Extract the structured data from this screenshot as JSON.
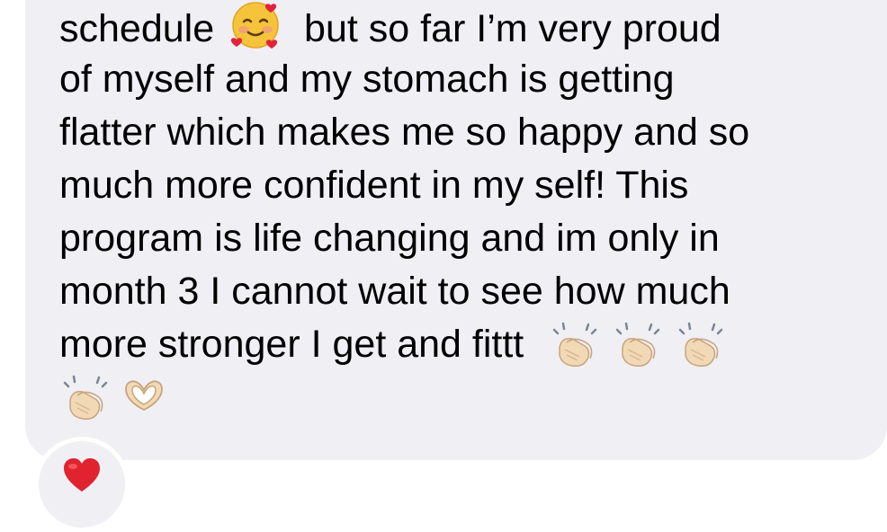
{
  "message": {
    "lines": [
      "schedule",
      "but so far I’m very proud",
      "of myself and my stomach is getting",
      "flatter which makes me so happy and so",
      "much more confident in my self! This",
      "program is life changing and im only in",
      "month 3 I cannot wait to see how much",
      "more stronger I get and fittt"
    ],
    "emojis": [
      "smiling-face-with-hearts-icon",
      "clapping-hands-icon",
      "clapping-hands-icon",
      "clapping-hands-icon",
      "clapping-hands-icon",
      "heart-hands-icon"
    ]
  },
  "reaction": {
    "icon": "red-heart-icon",
    "color": "#e0232e"
  },
  "colors": {
    "bubble": "#efeff4",
    "text": "#000000",
    "background": "#ffffff"
  }
}
